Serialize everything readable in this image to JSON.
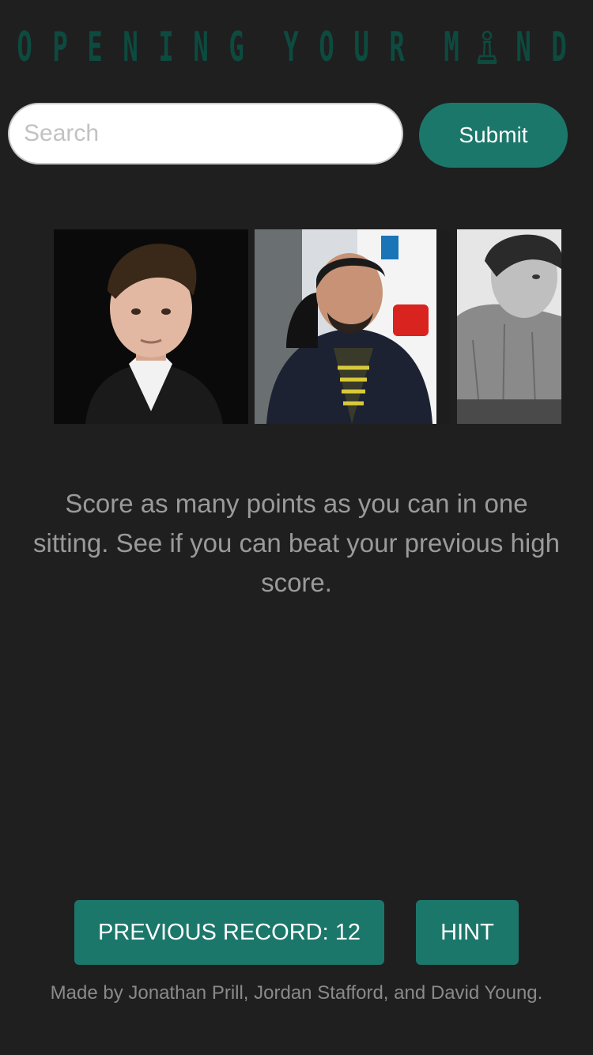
{
  "title": {
    "part1": [
      "O",
      "P",
      "E",
      "N",
      "I",
      "N",
      "G"
    ],
    "part2": [
      "Y",
      "O",
      "U",
      "R"
    ],
    "part3_before": [
      "M"
    ],
    "part3_after": [
      "N",
      "D"
    ],
    "pawn_icon": "chess-pawn-icon"
  },
  "search": {
    "placeholder": "Search",
    "value": "",
    "submit_label": "Submit"
  },
  "photos": [
    {
      "name": "player-photo-1"
    },
    {
      "name": "player-photo-2"
    },
    {
      "name": "player-photo-3"
    }
  ],
  "description": "Score as many points as you can in one sitting. See if you can beat your previous high score.",
  "buttons": {
    "record_label": "PREVIOUS RECORD: 12",
    "hint_label": "HINT"
  },
  "footer": "Made by Jonathan Prill, Jordan Stafford, and David Young.",
  "colors": {
    "background": "#1f1f1f",
    "accent": "#1c776b",
    "title": "#0d4a3f",
    "text_muted": "#9a9a9a"
  }
}
